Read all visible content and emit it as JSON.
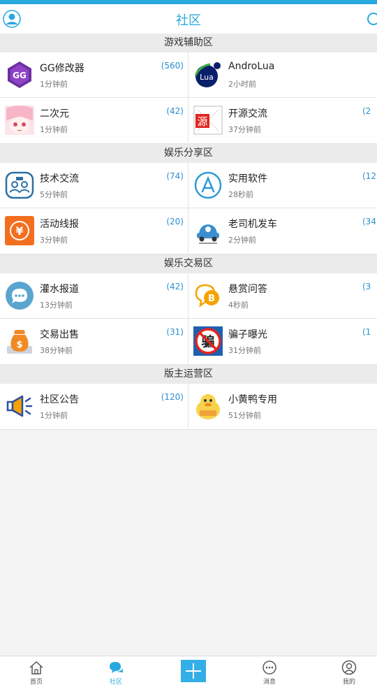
{
  "app": {
    "title": "社区"
  },
  "colors": {
    "accent": "#29a8e0",
    "count": "#2a8fd0"
  },
  "header": {
    "avatar_icon": "user-avatar-icon",
    "search_icon": "search-icon"
  },
  "sections": [
    {
      "title": "游戏辅助区",
      "forums": [
        {
          "name": "GG修改器",
          "time": "1分钟前",
          "count": "(560)",
          "icon": "gg-icon"
        },
        {
          "name": "AndroLua",
          "time": "2小时前",
          "count": "",
          "icon": "lua-icon"
        },
        {
          "name": "二次元",
          "time": "1分钟前",
          "count": "(42)",
          "icon": "anime-icon"
        },
        {
          "name": "开源交流",
          "time": "37分钟前",
          "count": "(2",
          "icon": "source-icon"
        }
      ]
    },
    {
      "title": "娱乐分享区",
      "forums": [
        {
          "name": "技术交流",
          "time": "5分钟前",
          "count": "(74)",
          "icon": "tech-icon"
        },
        {
          "name": "实用软件",
          "time": "28秒前",
          "count": "(12",
          "icon": "app-store-icon"
        },
        {
          "name": "活动线报",
          "time": "3分钟前",
          "count": "(20)",
          "icon": "yen-icon"
        },
        {
          "name": "老司机发车",
          "time": "2分钟前",
          "count": "(34",
          "icon": "car-icon"
        }
      ]
    },
    {
      "title": "娱乐交易区",
      "forums": [
        {
          "name": "灌水报道",
          "time": "13分钟前",
          "count": "(42)",
          "icon": "chat-icon"
        },
        {
          "name": "悬赏问答",
          "time": "4秒前",
          "count": "(3",
          "icon": "bitcoin-icon"
        },
        {
          "name": "交易出售",
          "time": "38分钟前",
          "count": "(31)",
          "icon": "money-bag-icon"
        },
        {
          "name": "骗子曝光",
          "time": "31分钟前",
          "count": "(1",
          "icon": "scam-icon"
        }
      ]
    },
    {
      "title": "版主运营区",
      "forums": [
        {
          "name": "社区公告",
          "time": "1分钟前",
          "count": "(120)",
          "icon": "megaphone-icon"
        },
        {
          "name": "小黄鸭专用",
          "time": "51分钟前",
          "count": "",
          "icon": "duck-icon"
        }
      ]
    }
  ],
  "tabs": [
    {
      "label": "首页",
      "icon": "home-icon",
      "active": false
    },
    {
      "label": "社区",
      "icon": "community-icon",
      "active": true
    },
    {
      "label": "消息",
      "icon": "message-icon",
      "active": false
    },
    {
      "label": "我的",
      "icon": "profile-icon",
      "active": false
    }
  ],
  "post_button": {
    "icon": "plus-icon"
  }
}
